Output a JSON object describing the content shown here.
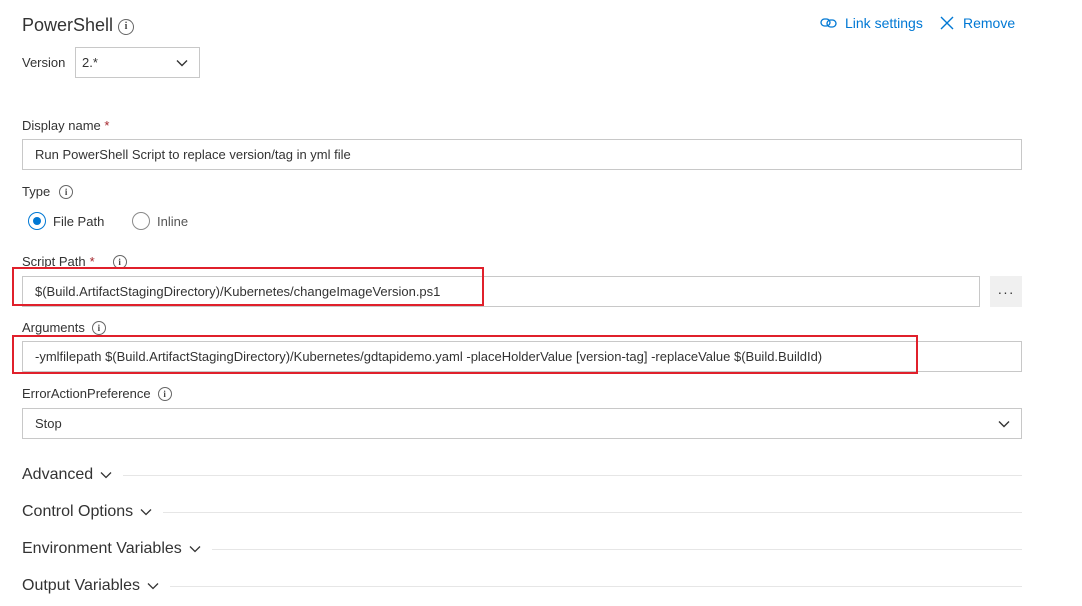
{
  "task": {
    "title": "PowerShell",
    "link_settings_label": "Link settings",
    "remove_label": "Remove"
  },
  "version": {
    "label": "Version",
    "value": "2.*"
  },
  "display_name": {
    "label": "Display name",
    "required_mark": "*",
    "value": "Run PowerShell Script to replace version/tag in yml file"
  },
  "type": {
    "label": "Type",
    "options": [
      {
        "label": "File Path",
        "selected": true
      },
      {
        "label": "Inline",
        "selected": false
      }
    ]
  },
  "script_path": {
    "label": "Script Path",
    "required_mark": "*",
    "value": "$(Build.ArtifactStagingDirectory)/Kubernetes/changeImageVersion.ps1",
    "browse_label": "···"
  },
  "arguments": {
    "label": "Arguments",
    "value": "-ymlfilepath $(Build.ArtifactStagingDirectory)/Kubernetes/gdtapidemo.yaml -placeHolderValue [version-tag] -replaceValue $(Build.BuildId)"
  },
  "error_action": {
    "label": "ErrorActionPreference",
    "value": "Stop"
  },
  "sections": [
    {
      "label": "Advanced"
    },
    {
      "label": "Control Options"
    },
    {
      "label": "Environment Variables"
    },
    {
      "label": "Output Variables"
    }
  ],
  "colors": {
    "accent": "#0078d4",
    "highlight": "#e0202b",
    "required": "#a4262c"
  }
}
